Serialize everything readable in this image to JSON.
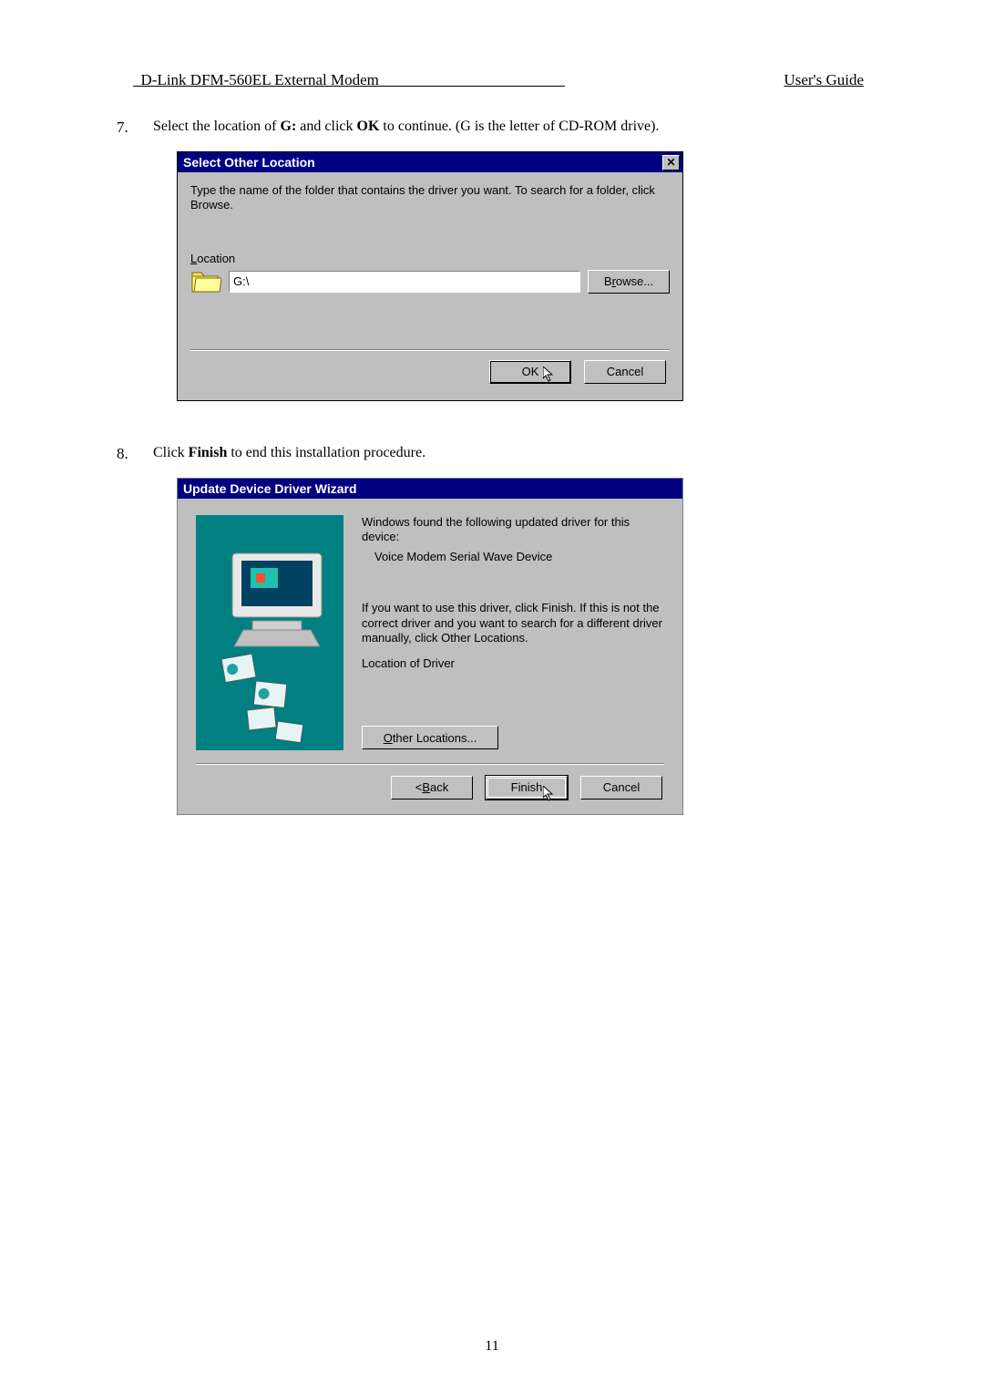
{
  "header": {
    "left": "  D-Link DFM-560EL External Modem                                                ",
    "right": "User's Guide"
  },
  "steps": {
    "s7": {
      "num": "7.",
      "text_before": "Select the location of ",
      "bold1": "G:",
      "text_mid": " and click ",
      "bold2": "OK",
      "text_after": " to continue. (G is the letter of CD-ROM drive)."
    },
    "s8": {
      "num": "8.",
      "text_before": "Click ",
      "bold1": "Finish",
      "text_after": " to end this installation procedure."
    }
  },
  "dlg1": {
    "title": "Select Other Location",
    "instruction": "Type the name of the folder that contains the driver you want. To search for a folder, click Browse.",
    "location_letter": "L",
    "location_rest": "ocation",
    "location_value": "G:\\",
    "browse_underline": "r",
    "browse_before": "B",
    "browse_after": "owse...",
    "ok": "OK",
    "cancel": "Cancel"
  },
  "dlg2": {
    "title": "Update Device Driver Wizard",
    "para1": "Windows found the following updated driver for this device:",
    "device": "Voice Modem Serial Wave Device",
    "para2": "If you want to use this driver, click Finish. If this is not the correct driver and you want to search for a different driver manually, click Other Locations.",
    "locdrv": "Location of Driver",
    "other_underline": "O",
    "other_rest": "ther Locations...",
    "back_lt": "< ",
    "back_underline": "B",
    "back_rest": "ack",
    "finish": "Finish",
    "cancel": "Cancel"
  },
  "page_number": "11"
}
